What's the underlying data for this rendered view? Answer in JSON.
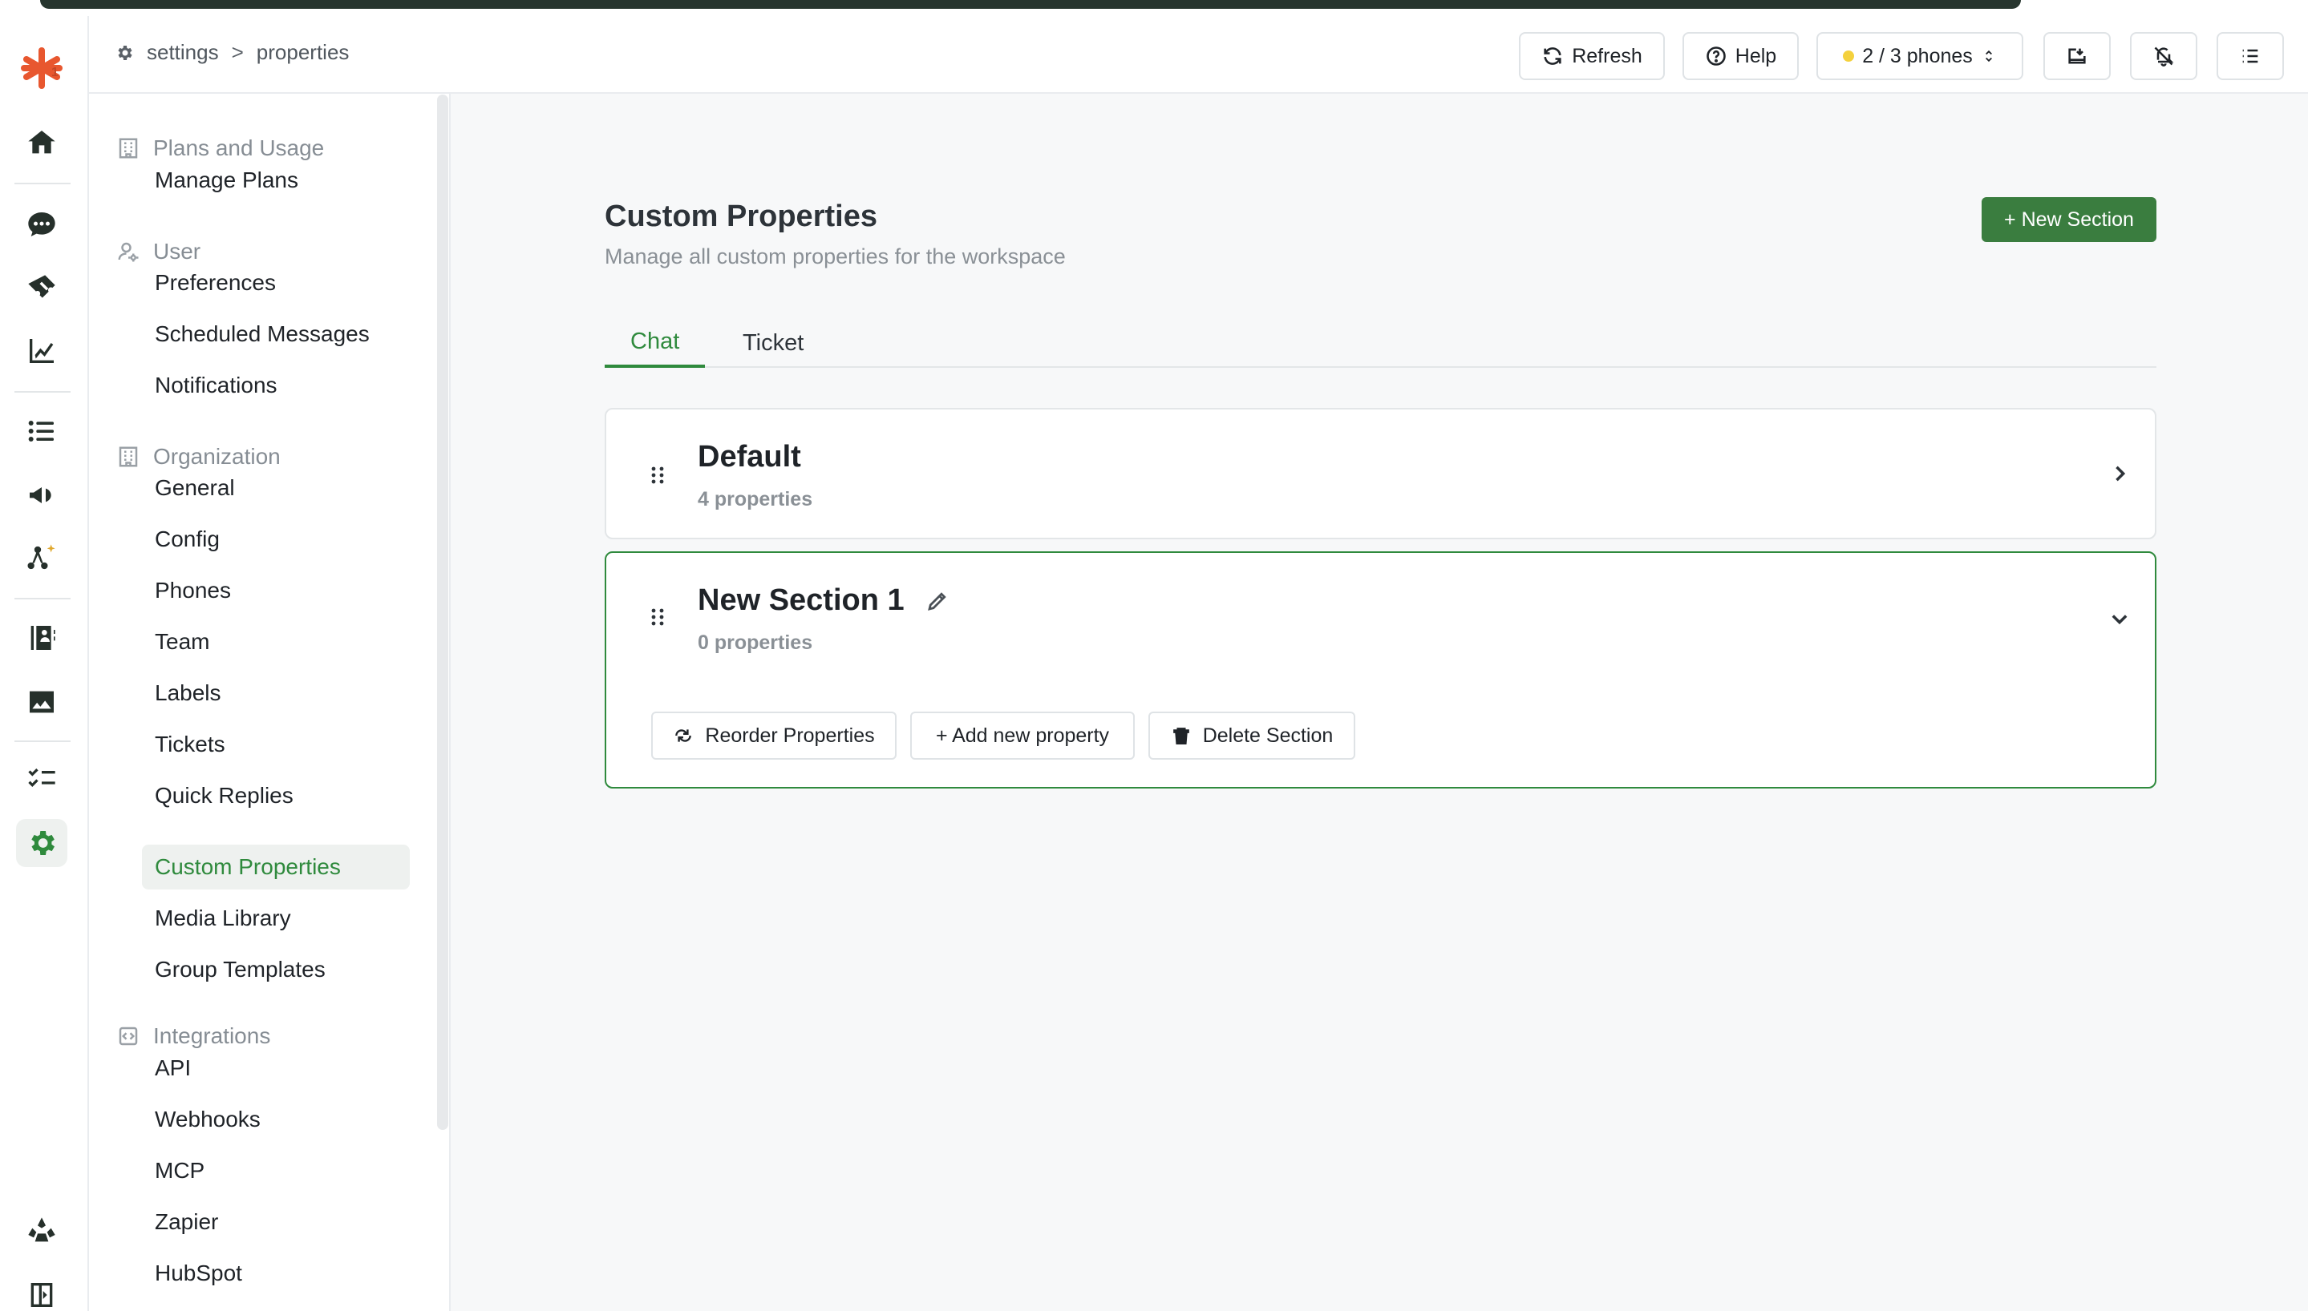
{
  "breadcrumb": {
    "root": "settings",
    "separator": ">",
    "current": "properties"
  },
  "header": {
    "refresh_label": "Refresh",
    "help_label": "Help",
    "phones_label": "2 / 3 phones",
    "phones_status_color": "#f4d13d"
  },
  "rail": {
    "logo_badge": "1",
    "icons": [
      "home-icon",
      "chat-icon",
      "ticket-icon",
      "analytics-icon",
      "list-icon",
      "megaphone-icon",
      "workflow-ai-icon",
      "contacts-book-icon",
      "media-icon",
      "tasks-icon",
      "settings-icon",
      "integrations-icon",
      "collapse-sidebar-icon"
    ]
  },
  "sidebar": {
    "groups": [
      {
        "label": "Plans and Usage",
        "icon": "building-icon",
        "items": [
          "Manage Plans"
        ]
      },
      {
        "label": "User",
        "icon": "user-settings-icon",
        "items": [
          "Preferences",
          "Scheduled Messages",
          "Notifications"
        ]
      },
      {
        "label": "Organization",
        "icon": "building-icon",
        "items": [
          "General",
          "Config",
          "Phones",
          "Team",
          "Labels",
          "Tickets",
          "Quick Replies",
          "Custom Properties",
          "Media Library",
          "Group Templates"
        ]
      },
      {
        "label": "Integrations",
        "icon": "code-icon",
        "items": [
          "API",
          "Webhooks",
          "MCP",
          "Zapier",
          "HubSpot"
        ]
      }
    ],
    "active_item": "Custom Properties"
  },
  "page": {
    "title": "Custom Properties",
    "subtitle": "Manage all custom properties for the workspace",
    "new_section_label": "+ New Section",
    "tabs": [
      {
        "label": "Chat",
        "active": true
      },
      {
        "label": "Ticket",
        "active": false
      }
    ]
  },
  "sections": [
    {
      "title": "Default",
      "count_label": "4 properties",
      "expanded": false
    },
    {
      "title": "New Section 1",
      "count_label": "0 properties",
      "expanded": true,
      "actions": {
        "reorder": "Reorder Properties",
        "add": "+ Add new property",
        "delete": "Delete Section"
      }
    }
  ],
  "colors": {
    "accent": "#2f8a3d",
    "primary_button": "#3a7d3f"
  }
}
